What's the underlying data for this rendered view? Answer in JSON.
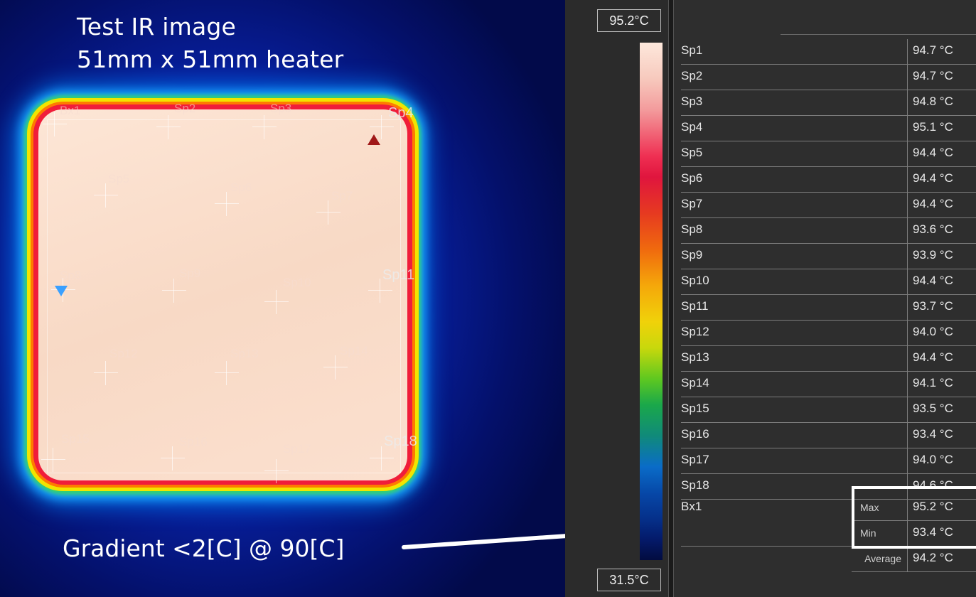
{
  "caption": {
    "line1": "Test IR image",
    "line2": "51mm x 51mm heater"
  },
  "gradient_note": "Gradient <2[C] @ 90[C]",
  "scale": {
    "max": "95.2°C",
    "min": "31.5°C"
  },
  "spots_overlay": [
    {
      "label": "Bx1"
    },
    {
      "label": "Sp2"
    },
    {
      "label": "Sp3"
    },
    {
      "label": "Sp4"
    },
    {
      "label": "Sp5"
    },
    {
      "label": "Sp6"
    },
    {
      "label": "Sp7"
    },
    {
      "label": "Sp8"
    },
    {
      "label": "Sp9"
    },
    {
      "label": "Sp10"
    },
    {
      "label": "Sp11"
    },
    {
      "label": "Sp12"
    },
    {
      "label": "Sp13"
    },
    {
      "label": "Sp14"
    },
    {
      "label": "Sp15"
    },
    {
      "label": "Sp16"
    },
    {
      "label": "Sp17"
    },
    {
      "label": "Sp18"
    }
  ],
  "measurements": [
    {
      "name": "Sp1",
      "value": "94.7 °C"
    },
    {
      "name": "Sp2",
      "value": "94.7 °C"
    },
    {
      "name": "Sp3",
      "value": "94.8 °C"
    },
    {
      "name": "Sp4",
      "value": "95.1 °C"
    },
    {
      "name": "Sp5",
      "value": "94.4 °C"
    },
    {
      "name": "Sp6",
      "value": "94.4 °C"
    },
    {
      "name": "Sp7",
      "value": "94.4 °C"
    },
    {
      "name": "Sp8",
      "value": "93.6 °C"
    },
    {
      "name": "Sp9",
      "value": "93.9 °C"
    },
    {
      "name": "Sp10",
      "value": "94.4 °C"
    },
    {
      "name": "Sp11",
      "value": "93.7 °C"
    },
    {
      "name": "Sp12",
      "value": "94.0 °C"
    },
    {
      "name": "Sp13",
      "value": "94.4 °C"
    },
    {
      "name": "Sp14",
      "value": "94.1 °C"
    },
    {
      "name": "Sp15",
      "value": "93.5 °C"
    },
    {
      "name": "Sp16",
      "value": "93.4 °C"
    },
    {
      "name": "Sp17",
      "value": "94.0 °C"
    },
    {
      "name": "Sp18",
      "value": "94.6 °C"
    }
  ],
  "box": {
    "name": "Bx1",
    "max_label": "Max",
    "max_value": "95.2 °C",
    "min_label": "Min",
    "min_value": "93.4 °C",
    "avg_label": "Average",
    "avg_value": "94.2 °C"
  },
  "colors": {
    "max_marker": "#a01818",
    "min_marker": "#3aa0ff",
    "panel_bg": "#2e2e2e"
  },
  "icons": {
    "max_marker": "triangle-up-icon",
    "min_marker": "triangle-down-icon"
  }
}
